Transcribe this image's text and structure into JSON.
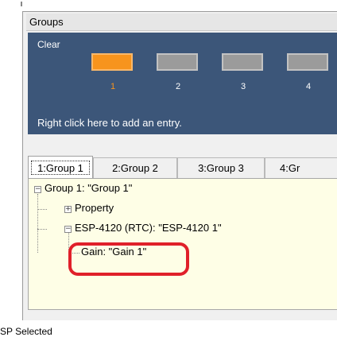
{
  "panel": {
    "title": "Groups"
  },
  "selector": {
    "clear_label": "Clear",
    "slots": [
      {
        "number": "1",
        "active": true
      },
      {
        "number": "2",
        "active": false
      },
      {
        "number": "3",
        "active": false
      },
      {
        "number": "4",
        "active": false
      }
    ],
    "hint": "Right click here to add an entry."
  },
  "tabs": [
    {
      "label": "1:Group 1",
      "selected": true
    },
    {
      "label": "2:Group 2",
      "selected": false
    },
    {
      "label": "3:Group 3",
      "selected": false
    },
    {
      "label": "4:Gr",
      "selected": false
    }
  ],
  "tree": {
    "root": {
      "label": "Group 1: \"Group 1\"",
      "expander": "⊟"
    },
    "property": {
      "label": "Property",
      "expander": "⊞"
    },
    "device": {
      "label": "ESP-4120 (RTC): \"ESP-4120 1\"",
      "expander": "⊟"
    },
    "gain": {
      "label": "Gain: \"Gain 1\""
    }
  },
  "status_partial": "SP Selected",
  "colors": {
    "selector_bg": "#3c5679",
    "active_slot": "#f7941d",
    "inactive_slot": "#9b9b9b",
    "tree_bg": "#fefee6",
    "highlight": "#e0202a"
  }
}
